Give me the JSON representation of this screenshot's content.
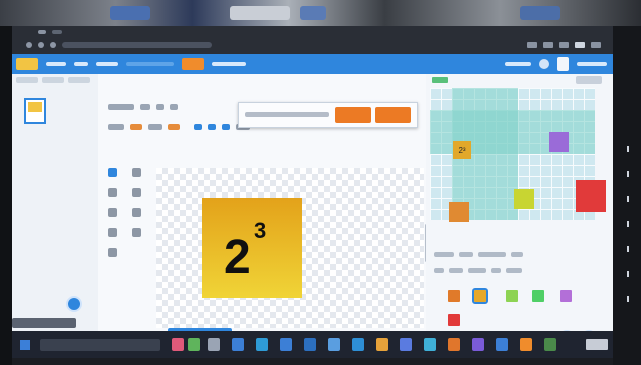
{
  "image_card": {
    "base": "2",
    "exponent": "3"
  },
  "grid_tiles": [
    {
      "label": "2³",
      "color": "#e2a82a"
    },
    {
      "label": "",
      "color": "#9a6bd8"
    },
    {
      "label": "",
      "color": "#e08a32"
    },
    {
      "label": "",
      "color": "#c8d532"
    },
    {
      "label": "",
      "color": "#e13a3a"
    }
  ],
  "swatches": [
    {
      "color": "#e07a2a"
    },
    {
      "color": "#e6a82a"
    },
    {
      "color": "#8dd353"
    },
    {
      "color": "#4fcf66"
    },
    {
      "color": "#b36fd8"
    },
    {
      "color": "#e13a3a"
    }
  ],
  "colors": {
    "accent": "#2f86dd",
    "dialog_button": "#ec7a24",
    "card_top": "#e3a21a",
    "card_bottom": "#f0d437"
  }
}
